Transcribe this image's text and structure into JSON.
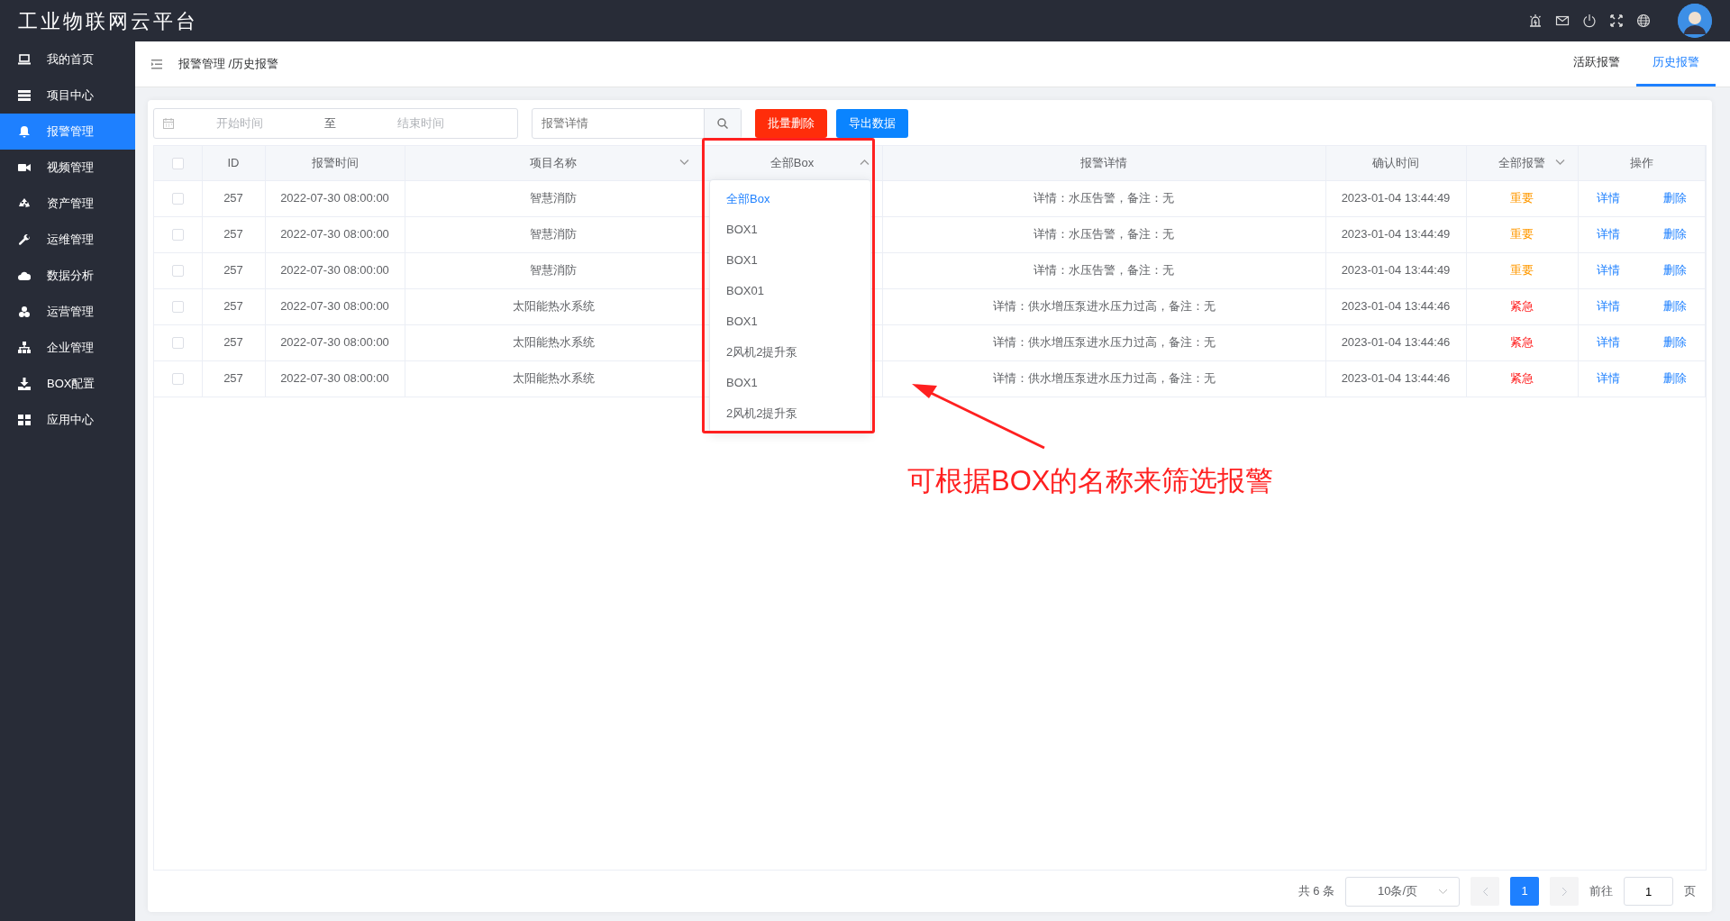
{
  "app_title": "工业物联网云平台",
  "sidebar": {
    "items": [
      {
        "label": "我的首页",
        "selected": false
      },
      {
        "label": "项目中心",
        "selected": false
      },
      {
        "label": "报警管理",
        "selected": true
      },
      {
        "label": "视频管理",
        "selected": false
      },
      {
        "label": "资产管理",
        "selected": false
      },
      {
        "label": "运维管理",
        "selected": false
      },
      {
        "label": "数据分析",
        "selected": false
      },
      {
        "label": "运营管理",
        "selected": false
      },
      {
        "label": "企业管理",
        "selected": false
      },
      {
        "label": "BOX配置",
        "selected": false
      },
      {
        "label": "应用中心",
        "selected": false
      }
    ]
  },
  "breadcrumb": "报警管理 /历史报警",
  "tabs": [
    {
      "label": "活跃报警",
      "selected": false
    },
    {
      "label": "历史报警",
      "selected": true
    }
  ],
  "toolbar": {
    "start_placeholder": "开始时间",
    "separator": "至",
    "end_placeholder": "结束时间",
    "search_placeholder": "报警详情",
    "buttons": [
      {
        "label": "批量删除",
        "kind": "danger"
      },
      {
        "label": "导出数据",
        "kind": "primary"
      }
    ]
  },
  "table": {
    "select_all_checked": false,
    "columns": [
      {
        "label": "ID",
        "kind": "plain"
      },
      {
        "label": "报警时间",
        "kind": "plain"
      },
      {
        "label": "项目名称",
        "kind": "filter",
        "expanded": false
      },
      {
        "label": "全部Box",
        "kind": "filter",
        "expanded": true
      },
      {
        "label": "报警详情",
        "kind": "plain"
      },
      {
        "label": "确认时间",
        "kind": "plain"
      },
      {
        "label": "全部报警",
        "kind": "filter",
        "expanded": false
      },
      {
        "label": "操作",
        "kind": "plain"
      }
    ],
    "rows": [
      {
        "checked": false,
        "id": "257",
        "alarm_time": "2022-07-30 08:00:00",
        "project": "智慧消防",
        "detail": "详情：水压告警，备注：无",
        "confirm_time": "2023-01-04 13:44:49",
        "level": "重要",
        "color": "#ff9900",
        "actions": [
          "详情",
          "删除"
        ]
      },
      {
        "checked": false,
        "id": "257",
        "alarm_time": "2022-07-30 08:00:00",
        "project": "智慧消防",
        "detail": "详情：水压告警，备注：无",
        "confirm_time": "2023-01-04 13:44:49",
        "level": "重要",
        "color": "#ff9900",
        "actions": [
          "详情",
          "删除"
        ]
      },
      {
        "checked": false,
        "id": "257",
        "alarm_time": "2022-07-30 08:00:00",
        "project": "智慧消防",
        "detail": "详情：水压告警，备注：无",
        "confirm_time": "2023-01-04 13:44:49",
        "level": "重要",
        "color": "#ff9900",
        "actions": [
          "详情",
          "删除"
        ]
      },
      {
        "checked": false,
        "id": "257",
        "alarm_time": "2022-07-30 08:00:00",
        "project": "太阳能热水系统",
        "detail": "详情：供水增压泵进水压力过高，备注：无",
        "confirm_time": "2023-01-04 13:44:46",
        "level": "紧急",
        "color": "#ff2020",
        "actions": [
          "详情",
          "删除"
        ]
      },
      {
        "checked": false,
        "id": "257",
        "alarm_time": "2022-07-30 08:00:00",
        "project": "太阳能热水系统",
        "detail": "详情：供水增压泵进水压力过高，备注：无",
        "confirm_time": "2023-01-04 13:44:46",
        "level": "紧急",
        "color": "#ff2020",
        "actions": [
          "详情",
          "删除"
        ]
      },
      {
        "checked": false,
        "id": "257",
        "alarm_time": "2022-07-30 08:00:00",
        "project": "太阳能热水系统",
        "detail": "详情：供水增压泵进水压力过高，备注：无",
        "confirm_time": "2023-01-04 13:44:46",
        "level": "紧急",
        "color": "#ff2020",
        "actions": [
          "详情",
          "删除"
        ]
      }
    ]
  },
  "box_dropdown": {
    "items": [
      {
        "label": "全部Box",
        "selected": true
      },
      {
        "label": "BOX1",
        "selected": false
      },
      {
        "label": "BOX1",
        "selected": false
      },
      {
        "label": "BOX01",
        "selected": false
      },
      {
        "label": "BOX1",
        "selected": false
      },
      {
        "label": "2风机2提升泵",
        "selected": false
      },
      {
        "label": "BOX1",
        "selected": false
      },
      {
        "label": "2风机2提升泵",
        "selected": false
      }
    ]
  },
  "annotation": "可根据BOX的名称来筛选报警",
  "pagination": {
    "total": "共 6 条",
    "page_size": "10条/页",
    "pages": [
      {
        "label": "1",
        "selected": true
      }
    ],
    "goto_label": "前往",
    "goto_value": "1",
    "page_unit": "页"
  }
}
